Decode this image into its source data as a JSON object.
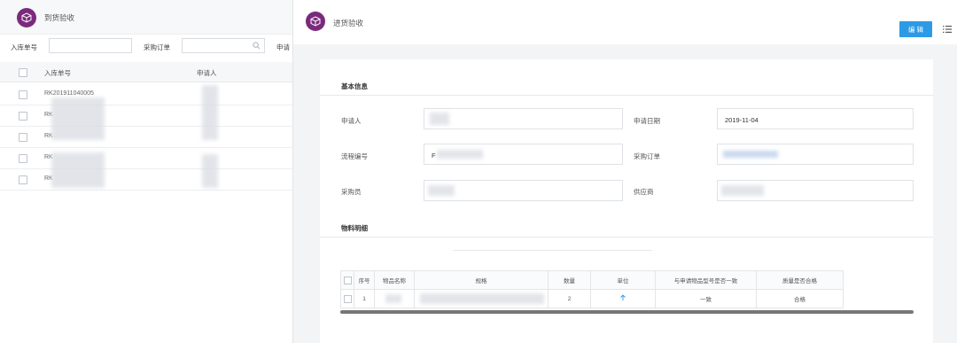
{
  "left_panel": {
    "title": "到货验收",
    "filters": {
      "inbound_no_label": "入库单号",
      "po_label": "采购订单",
      "applicant_label": "申请"
    },
    "columns": {
      "inbound_no": "入库单号",
      "applicant": "申请人"
    },
    "rows": [
      {
        "inbound_no": "RK201911040005"
      },
      {
        "inbound_no": "RK"
      },
      {
        "inbound_no": "RK"
      },
      {
        "inbound_no": "RK"
      },
      {
        "inbound_no": "RK"
      }
    ]
  },
  "detail": {
    "title": "进货验收",
    "edit_label": "编 辑",
    "basic_section": "基本信息",
    "fields": {
      "applicant_label": "申请人",
      "apply_date_label": "申请日期",
      "apply_date_value": "2019-11-04",
      "flow_no_label": "流程编号",
      "flow_no_value": "F",
      "po_label": "采购订单",
      "buyer_label": "采购员",
      "supplier_label": "供应商"
    },
    "materials_section": "物料明细",
    "table": {
      "headers": [
        "序号",
        "物品名称",
        "规格",
        "数量",
        "单位",
        "与申请物品型号是否一致",
        "质量是否合格"
      ],
      "rows": [
        {
          "seq": "1",
          "qty": "2",
          "unit_icon": "arrow-up-icon",
          "consistent": "一致",
          "quality": "合格"
        }
      ]
    }
  },
  "colors": {
    "brand": "#7a2a7d",
    "button": "#2d9ae6"
  }
}
